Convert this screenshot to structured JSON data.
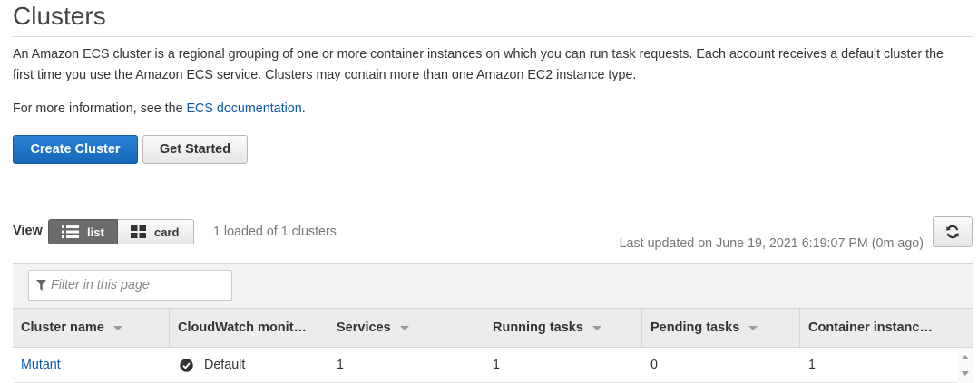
{
  "page": {
    "title": "Clusters",
    "description": "An Amazon ECS cluster is a regional grouping of one or more container instances on which you can run task requests. Each account receives a default cluster the first time you use the Amazon ECS service. Clusters may contain more than one Amazon EC2 instance type.",
    "more_info_prefix": "For more information, see the ",
    "more_info_link": "ECS documentation",
    "more_info_suffix": "."
  },
  "buttons": {
    "create": "Create Cluster",
    "get_started": "Get Started"
  },
  "view": {
    "label": "View",
    "list": "list",
    "card": "card",
    "selected": "list",
    "loaded_text": "1 loaded of 1 clusters",
    "last_updated": "Last updated on June 19, 2021 6:19:07 PM (0m ago)",
    "refresh_icon": "refresh-icon"
  },
  "filter": {
    "placeholder": "Filter in this page",
    "icon": "filter-icon"
  },
  "table": {
    "columns": [
      "Cluster name",
      "CloudWatch monit…",
      "Services",
      "Running tasks",
      "Pending tasks",
      "Container instanc…"
    ],
    "rows": [
      {
        "cluster_name": "Mutant",
        "cloudwatch": "Default",
        "services": "1",
        "running_tasks": "1",
        "pending_tasks": "0",
        "container_instances": "1"
      }
    ]
  },
  "colors": {
    "primary_button": "#1a70c7",
    "link": "#0e58ac",
    "selected_segment": "#6b6b6b"
  }
}
